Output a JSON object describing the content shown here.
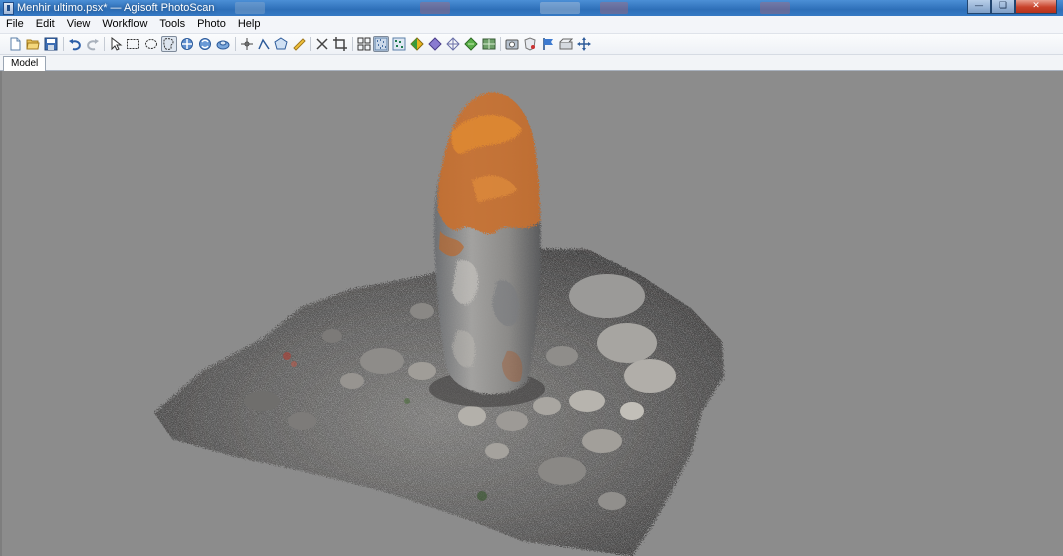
{
  "window": {
    "title": "Menhir ultimo.psx* — Agisoft PhotoScan",
    "controls": {
      "minimize_icon": "minimize-icon",
      "maximize_icon": "maximize-icon",
      "close_icon": "close-icon"
    }
  },
  "menu": {
    "items": [
      {
        "label": "File"
      },
      {
        "label": "Edit"
      },
      {
        "label": "View"
      },
      {
        "label": "Workflow"
      },
      {
        "label": "Tools"
      },
      {
        "label": "Photo"
      },
      {
        "label": "Help"
      }
    ]
  },
  "toolbar": {
    "icons": [
      "new-project-icon",
      "open-folder-icon",
      "save-icon",
      "undo-icon",
      "redo-icon",
      "navigation-arrow-icon",
      "rectangle-selection-icon",
      "circle-selection-icon",
      "free-form-selection-icon",
      "move-object-icon",
      "rotate-object-icon",
      "scale-object-icon",
      "add-marker-icon",
      "draw-polyline-icon",
      "draw-polygon-icon",
      "ruler-icon",
      "delete-selection-icon",
      "crop-selection-icon",
      "show-cameras-icon",
      "show-point-cloud-icon",
      "show-dense-cloud-icon",
      "shaded-model-icon",
      "solid-model-icon",
      "wireframe-model-icon",
      "textured-model-icon",
      "show-tiled-model-icon",
      "show-photos-icon",
      "show-shapes-icon",
      "show-markers-icon",
      "show-region-icon",
      "reset-view-icon"
    ],
    "pressed": [
      "free-form-selection-icon",
      "show-point-cloud-icon"
    ]
  },
  "tabs": [
    {
      "label": "Model",
      "active": true
    }
  ],
  "viewport": {
    "background_color": "#8c8c8c",
    "content": "dense-point-cloud"
  }
}
